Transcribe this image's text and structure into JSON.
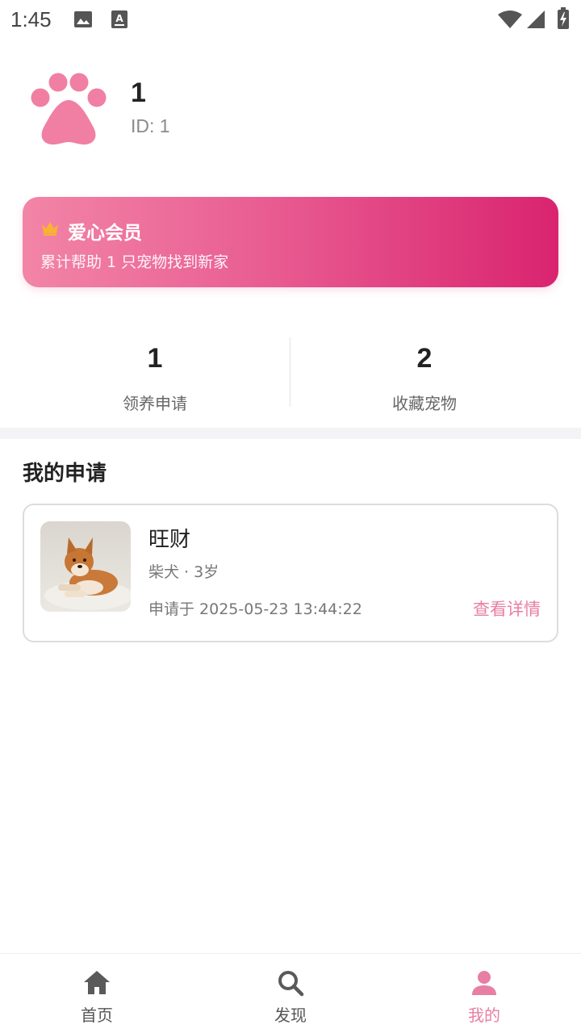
{
  "status_bar": {
    "time": "1:45",
    "left_icons": [
      "image-icon",
      "keyboard-a-icon"
    ],
    "right_icons": [
      "wifi-icon",
      "cell-signal-icon",
      "battery-charging-icon"
    ]
  },
  "profile": {
    "avatar_icon": "paw-icon",
    "name": "1",
    "id_text": "ID: 1"
  },
  "membership": {
    "icon": "crown-icon",
    "title": "爱心会员",
    "description": "累计帮助 1 只宠物找到新家"
  },
  "stats": [
    {
      "value": "1",
      "label": "领养申请"
    },
    {
      "value": "2",
      "label": "收藏宠物"
    }
  ],
  "applications": {
    "title": "我的申请",
    "items": [
      {
        "pet_name": "旺财",
        "meta": "柴犬 · 3岁",
        "applied_at": "申请于 2025-05-23 13:44:22",
        "action_label": "查看详情"
      }
    ]
  },
  "bottom_nav": {
    "items": [
      {
        "label": "首页",
        "icon": "home-icon",
        "active": false
      },
      {
        "label": "发现",
        "icon": "search-icon",
        "active": false
      },
      {
        "label": "我的",
        "icon": "person-icon",
        "active": true
      }
    ]
  },
  "colors": {
    "accent": "#e87ea3",
    "banner_start": "#f285a7",
    "banner_end": "#d9246f",
    "crown": "#f9b233"
  }
}
